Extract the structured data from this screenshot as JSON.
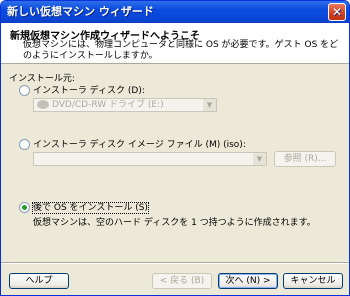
{
  "window": {
    "title": "新しい仮想マシン ウィザード",
    "close_glyph": "✕"
  },
  "header": {
    "title": "新規仮想マシン作成ウィザードへようこそ",
    "description": "仮想マシンには、物理コンピュータと同様に OS が必要です。ゲスト OS をどのようにインストールしますか。"
  },
  "install_source": {
    "group_label": "インストール元:",
    "installer_disc": {
      "label": "インストーラ ディスク (D):",
      "selected": false,
      "drive_value": "DVD/CD-RW ドライブ (E:)"
    },
    "installer_image": {
      "label": "インストーラ ディスク イメージ ファイル (M) (iso):",
      "selected": false,
      "path_value": "",
      "browse_label": "参照 (R)..."
    },
    "install_later": {
      "label": "後で OS をインストール (S)",
      "selected": true,
      "note": "仮想マシンは、空のハード ディスクを 1 つ持つように作成されます。"
    }
  },
  "footer": {
    "help_label": "ヘルプ",
    "back_label": "< 戻る (B)",
    "next_label": "次へ (N) >",
    "cancel_label": "キャンセル"
  }
}
